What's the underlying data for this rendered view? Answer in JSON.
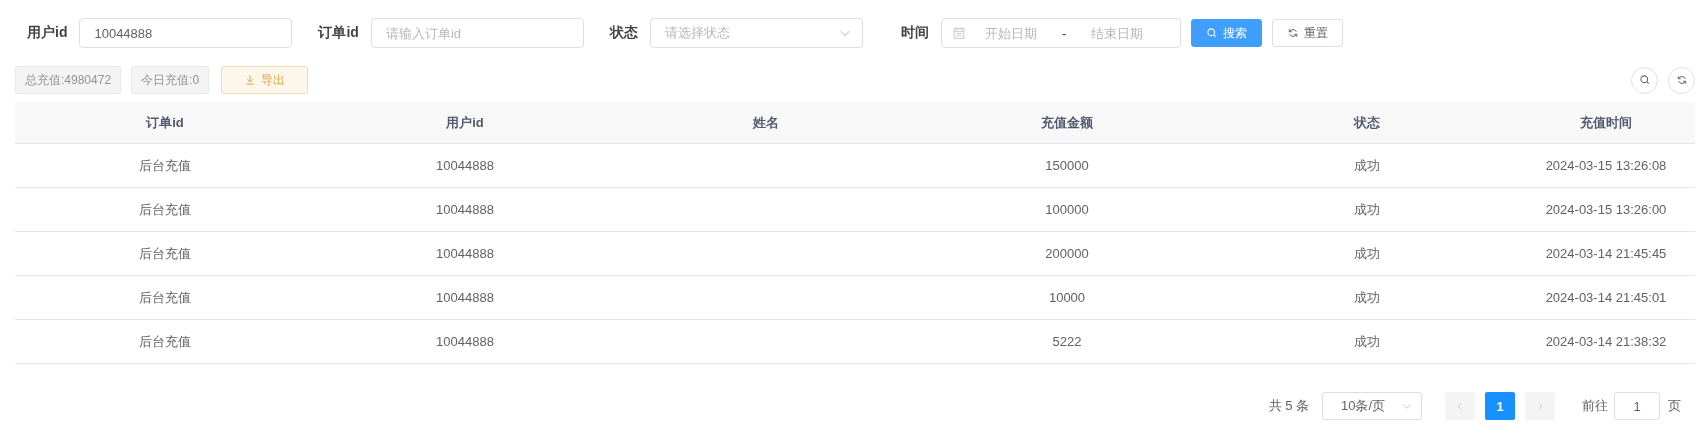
{
  "filters": [
    {
      "kind": "input",
      "label": "用户id",
      "value": "10044888"
    },
    {
      "kind": "input",
      "label": "订单id",
      "placeholder": "请输入订单id"
    },
    {
      "kind": "select",
      "label": "状态",
      "placeholder": "请选择状态"
    },
    {
      "kind": "daterange",
      "label": "时间",
      "start_placeholder": "开始日期",
      "separator": "-",
      "end_placeholder": "结束日期"
    }
  ],
  "actions": [
    {
      "kind": "primary",
      "label": "搜索"
    },
    {
      "kind": "reset",
      "label": "重置"
    }
  ],
  "stats": [
    "总充值:4980472",
    "今日充值:0"
  ],
  "export_button": "导出",
  "table": {
    "columns": [
      "订单id",
      "用户id",
      "姓名",
      "充值金额",
      "状态",
      "充值时间"
    ],
    "rows": [
      [
        "后台充值",
        "10044888",
        "",
        "150000",
        "成功",
        "2024-03-15 13:26:08"
      ],
      [
        "后台充值",
        "10044888",
        "",
        "100000",
        "成功",
        "2024-03-15 13:26:00"
      ],
      [
        "后台充值",
        "10044888",
        "",
        "200000",
        "成功",
        "2024-03-14 21:45:45"
      ],
      [
        "后台充值",
        "10044888",
        "",
        "10000",
        "成功",
        "2024-03-14 21:45:01"
      ],
      [
        "后台充值",
        "10044888",
        "",
        "5222",
        "成功",
        "2024-03-14 21:38:32"
      ]
    ]
  },
  "pagination": {
    "total": "共 5 条",
    "page_size": "10条/页",
    "pages": [
      {
        "label": "1",
        "selected": true
      }
    ],
    "goto_label": "前往",
    "goto_value": "1",
    "goto_suffix": "页"
  }
}
